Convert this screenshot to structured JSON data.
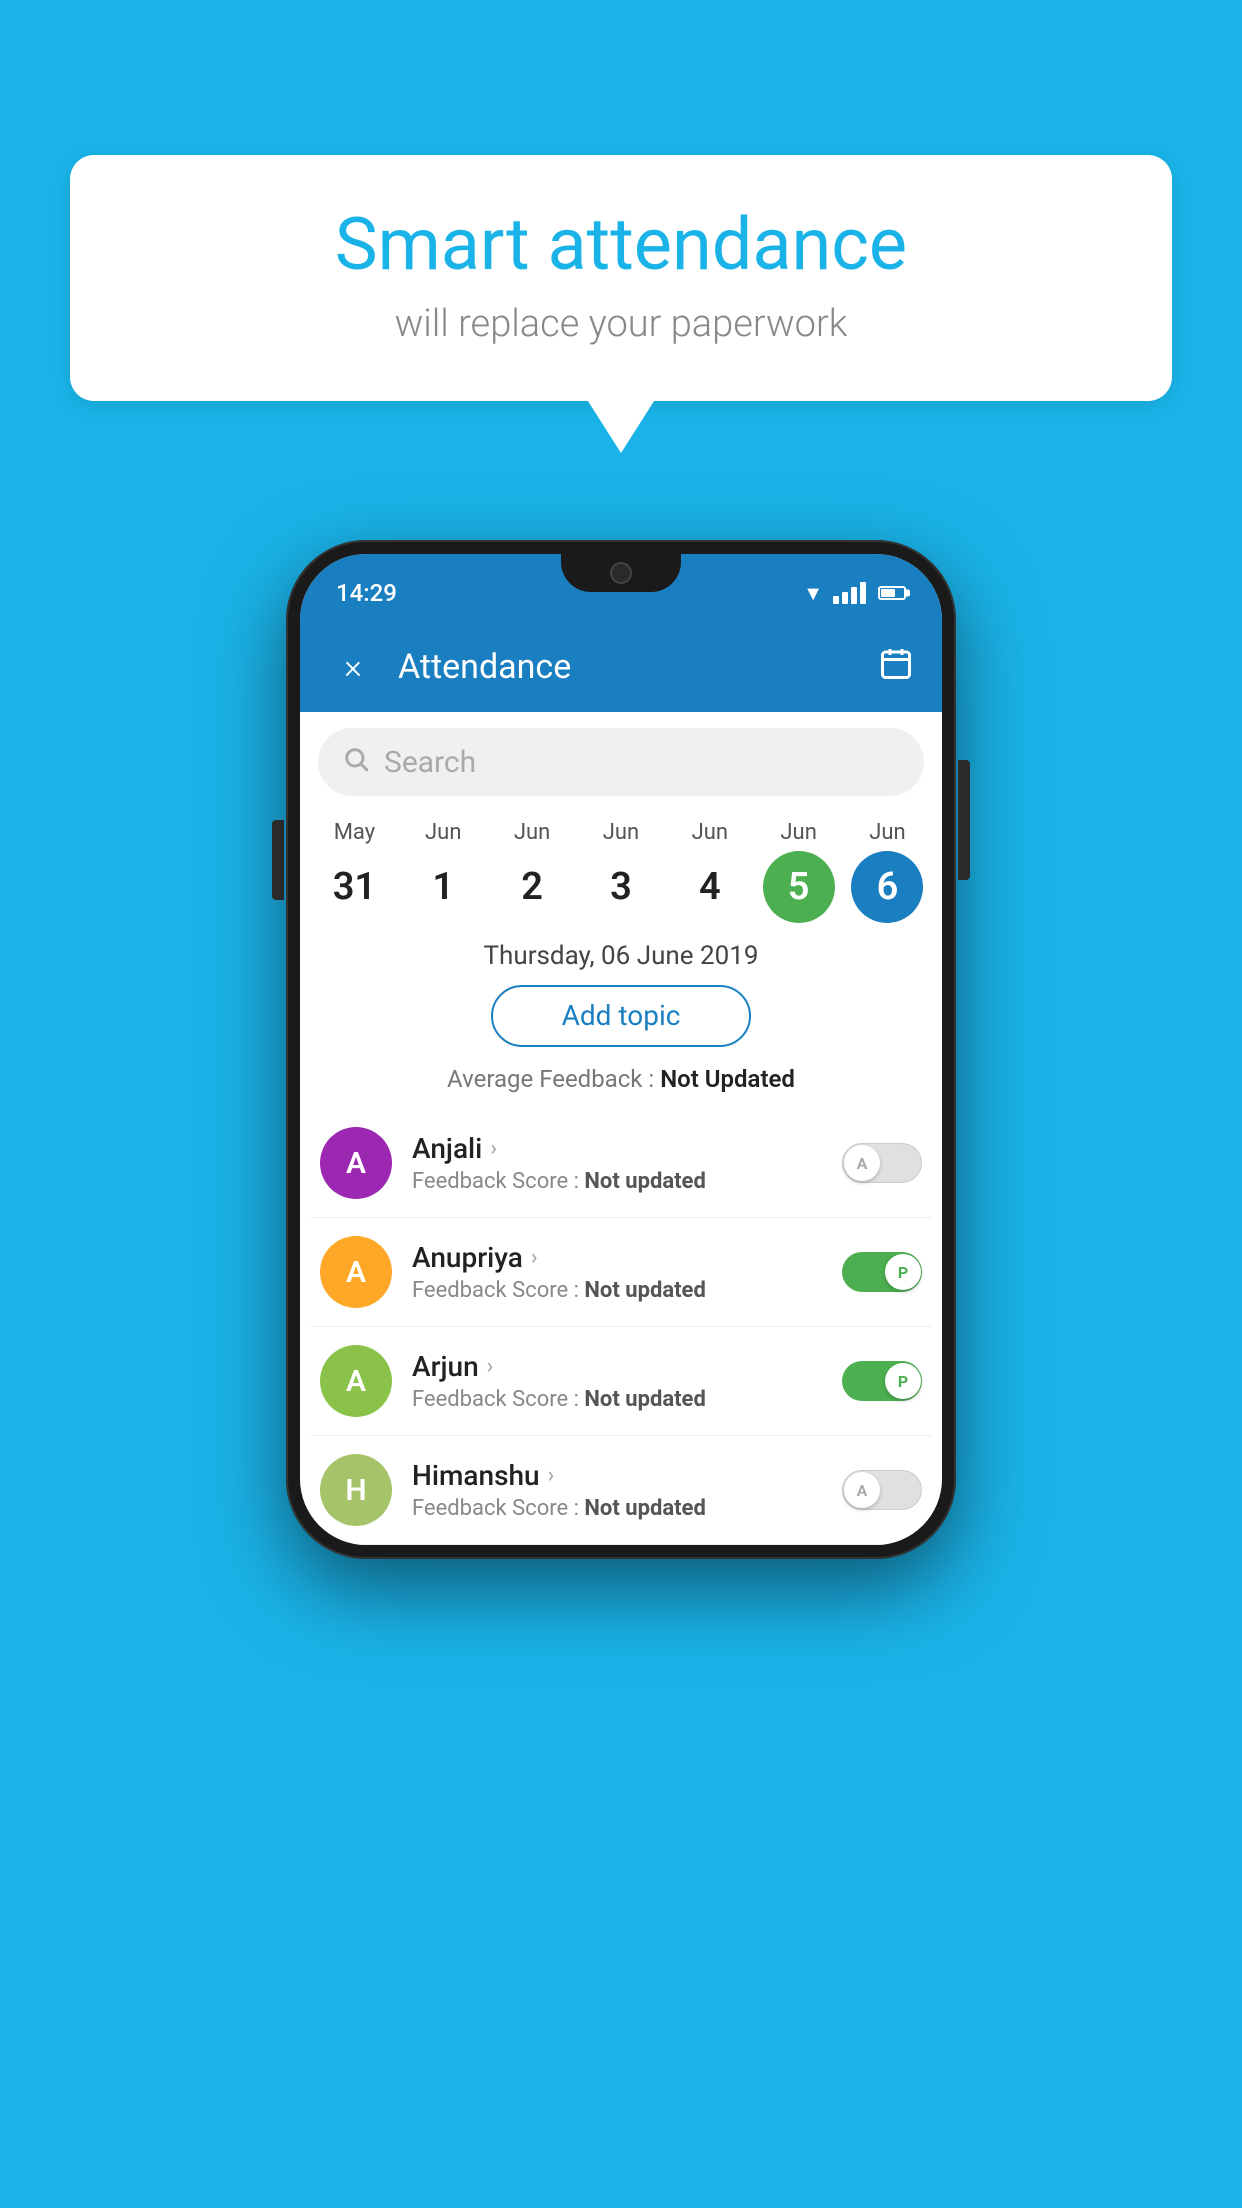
{
  "background_color": "#1ab3e8",
  "bubble": {
    "title": "Smart attendance",
    "subtitle": "will replace your paperwork"
  },
  "status_bar": {
    "time": "14:29"
  },
  "app_bar": {
    "title": "Attendance",
    "close_label": "×",
    "calendar_label": "📅"
  },
  "search": {
    "placeholder": "Search"
  },
  "calendar": {
    "days": [
      {
        "month": "May",
        "date": "31",
        "style": "normal"
      },
      {
        "month": "Jun",
        "date": "1",
        "style": "normal"
      },
      {
        "month": "Jun",
        "date": "2",
        "style": "normal"
      },
      {
        "month": "Jun",
        "date": "3",
        "style": "normal"
      },
      {
        "month": "Jun",
        "date": "4",
        "style": "normal"
      },
      {
        "month": "Jun",
        "date": "5",
        "style": "today"
      },
      {
        "month": "Jun",
        "date": "6",
        "style": "selected"
      }
    ],
    "selected_date_label": "Thursday, 06 June 2019"
  },
  "add_topic_button": "Add topic",
  "avg_feedback": {
    "label": "Average Feedback : ",
    "value": "Not Updated"
  },
  "students": [
    {
      "name": "Anjali",
      "avatar_letter": "A",
      "avatar_color": "#9c27b0",
      "feedback": "Feedback Score : ",
      "feedback_value": "Not updated",
      "toggle": "off",
      "toggle_letter": "A"
    },
    {
      "name": "Anupriya",
      "avatar_letter": "A",
      "avatar_color": "#ffa726",
      "feedback": "Feedback Score : ",
      "feedback_value": "Not updated",
      "toggle": "on",
      "toggle_letter": "P"
    },
    {
      "name": "Arjun",
      "avatar_letter": "A",
      "avatar_color": "#8bc34a",
      "feedback": "Feedback Score : ",
      "feedback_value": "Not updated",
      "toggle": "on",
      "toggle_letter": "P"
    },
    {
      "name": "Himanshu",
      "avatar_letter": "H",
      "avatar_color": "#a5c46a",
      "feedback": "Feedback Score : ",
      "feedback_value": "Not updated",
      "toggle": "off",
      "toggle_letter": "A"
    }
  ]
}
